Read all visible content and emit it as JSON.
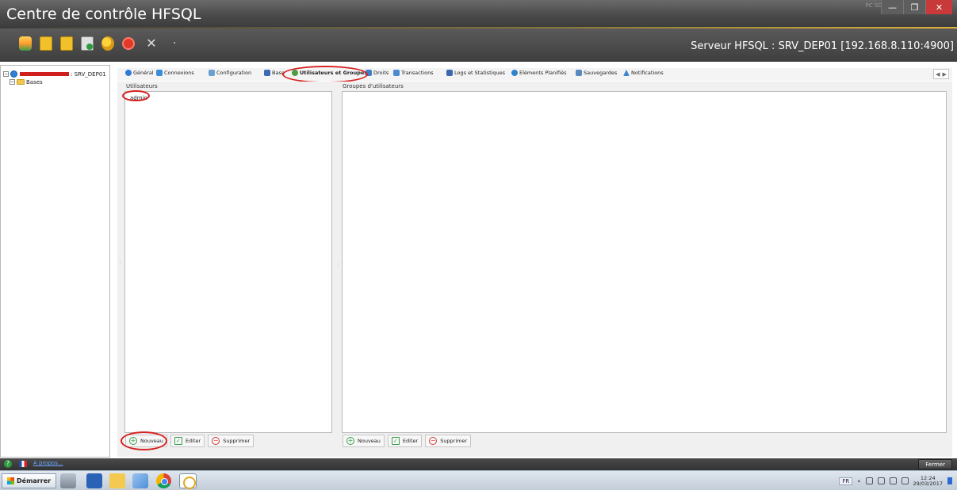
{
  "window": {
    "title": "Centre de contrôle HFSQL",
    "product_tag": "PC SOFT",
    "minimize_glyph": "—",
    "maximize_glyph": "❐",
    "close_glyph": "✕"
  },
  "toolbar": {
    "icons": [
      "database-icon",
      "document-icon",
      "document-icon",
      "document-add-icon",
      "group-icon",
      "stop-icon",
      "tools-icon"
    ],
    "tools_glyph": "✕",
    "dot": "·",
    "server_label": "Serveur HFSQL : SRV_DEP01 [192.168.8.110:4900]"
  },
  "tree": {
    "server_node_label": ": SRV_DEP01",
    "bases_label": "Bases",
    "expander_minus": "−"
  },
  "tabs": [
    {
      "label": "Général",
      "icon": "info-icon"
    },
    {
      "label": "Connexions",
      "icon": "connections-icon"
    },
    {
      "label": "Configuration",
      "icon": "config-icon"
    },
    {
      "label": "Base",
      "icon": "database-icon"
    },
    {
      "label": "Utilisateurs et Groupes",
      "icon": "users-icon",
      "active": true
    },
    {
      "label": "Droits",
      "icon": "rights-icon"
    },
    {
      "label": "Transactions",
      "icon": "transactions-icon"
    },
    {
      "label": "Logs et Statistiques",
      "icon": "logs-icon"
    },
    {
      "label": "Eléments Planifiés",
      "icon": "scheduled-icon"
    },
    {
      "label": "Sauvegardes",
      "icon": "backup-icon"
    },
    {
      "label": "Notifications",
      "icon": "notifications-icon"
    }
  ],
  "tab_nav": {
    "prev": "◀",
    "next": "▶"
  },
  "users_panel": {
    "label": "Utilisateurs",
    "items": [
      "admin"
    ],
    "buttons": {
      "new": "Nouveau",
      "edit": "Editer",
      "delete": "Supprimer"
    }
  },
  "groups_panel": {
    "label": "Groupes d'utilisateurs",
    "items": [],
    "buttons": {
      "new": "Nouveau",
      "edit": "Editer",
      "delete": "Supprimer"
    }
  },
  "button_glyphs": {
    "plus": "+",
    "minus": "−",
    "edit": "✓"
  },
  "statusbar": {
    "help_glyph": "?",
    "about_link": "A propos...",
    "close_button": "Fermer"
  },
  "taskbar": {
    "start_label": "Démarrer",
    "language": "FR",
    "tray_arrow": "«",
    "time": "12:24",
    "date": "29/03/2017"
  },
  "colors": {
    "annotation_red": "#d71f1f",
    "titlebar": "#4a4a4a",
    "accent_gold": "#e0b23b"
  }
}
